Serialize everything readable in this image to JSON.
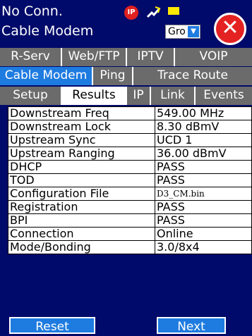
{
  "header": {
    "line1": "No Conn.",
    "line2": "Cable Modem",
    "group_value": "Gro",
    "ip_badge": "IP",
    "icons": [
      "ip-icon",
      "plug-icon",
      "battery-icon",
      "close-icon"
    ]
  },
  "tabs_row1": [
    "R-Serv",
    "Web/FTP",
    "IPTV",
    "VOIP"
  ],
  "tabs_row2": [
    "Cable Modem",
    "Ping",
    "Trace Route"
  ],
  "tabs_row3": [
    "Setup",
    "Results",
    "IP",
    "Link",
    "Events"
  ],
  "active": {
    "row2": "Cable Modem",
    "row3": "Results"
  },
  "results": [
    {
      "label": "Downstream Freq",
      "value": "549.00 MHz"
    },
    {
      "label": "Downstream Lock",
      "value": "8.30 dBmV"
    },
    {
      "label": "Upstream Sync",
      "value": "UCD 1"
    },
    {
      "label": "Upstream Ranging",
      "value": "36.00 dBmV"
    },
    {
      "label": "DHCP",
      "value": "PASS"
    },
    {
      "label": "TOD",
      "value": "PASS"
    },
    {
      "label": "Configuration File",
      "value": "D3_CM.bin"
    },
    {
      "label": "Registration",
      "value": "PASS"
    },
    {
      "label": "BPI",
      "value": "PASS"
    },
    {
      "label": "Connection",
      "value": "Online"
    },
    {
      "label": "Mode/Bonding",
      "value": "3.0/8x4"
    }
  ],
  "buttons": {
    "reset": "Reset",
    "next": "Next"
  },
  "colors": {
    "background": "#000a6a",
    "accent": "#1e7be0",
    "close": "#e42222",
    "tab_gray": "#6b6b6b"
  }
}
